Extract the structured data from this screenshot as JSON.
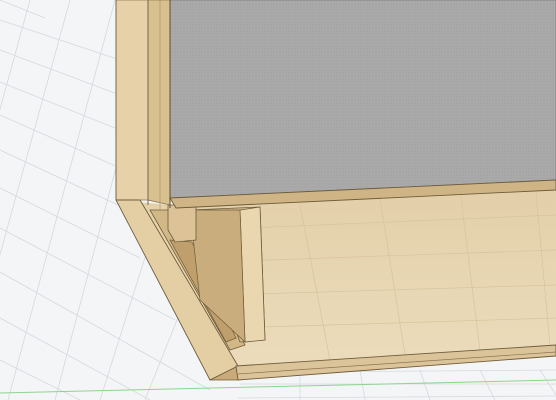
{
  "viewport": {
    "background": "#f4f5f7",
    "grid_color": "#c9d0da",
    "grid_minor_color": "#dde2e8",
    "x_axis_color": "#7fd07f"
  },
  "model": {
    "wood_light": "#ead7b0",
    "wood_mid": "#dcc394",
    "wood_dark": "#c6a873",
    "wood_shadow": "#a78a5b",
    "edge_line": "#6f5c3a",
    "panel_gray": "#a6a6a6",
    "panel_gray_light": "#b4b4b4"
  }
}
